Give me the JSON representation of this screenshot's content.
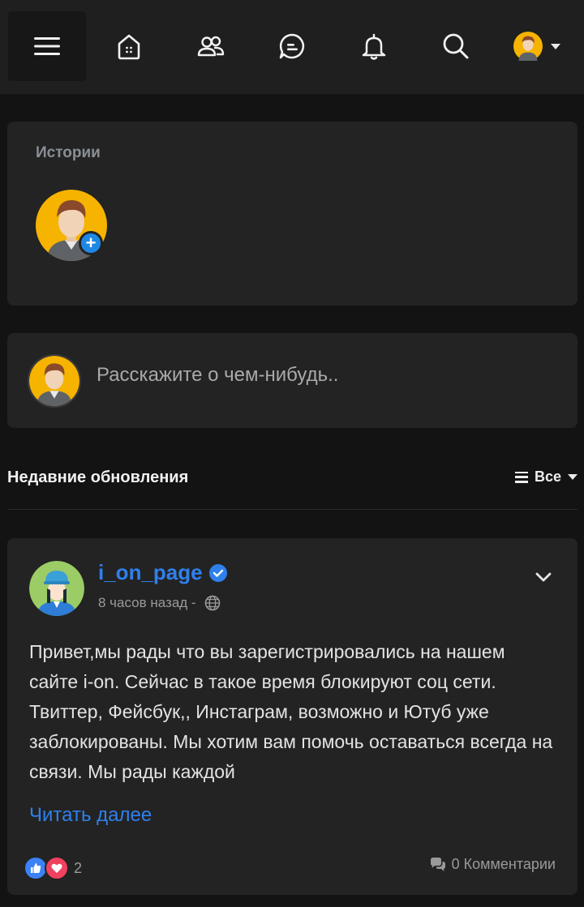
{
  "nav": {
    "items": [
      {
        "name": "menu-icon"
      },
      {
        "name": "home-icon"
      },
      {
        "name": "friends-icon"
      },
      {
        "name": "messages-icon"
      },
      {
        "name": "notifications-icon"
      },
      {
        "name": "search-icon"
      },
      {
        "name": "user-avatar-dropdown"
      }
    ]
  },
  "stories": {
    "title": "Истории"
  },
  "compose": {
    "placeholder": "Расскажите о чем-нибудь.."
  },
  "updates": {
    "title": "Недавние обновления",
    "filter_label": "Все"
  },
  "post": {
    "author": "i_on_page",
    "time": "8 часов назад -",
    "body": "Привет,мы рады что вы зарегистрировались на нашем сайте i-on. Сейчас в такое время блокируют соц сети. Твиттер, Фейсбук,, Инстаграм, возможно и Ютуб уже заблокированы. Мы хотим вам помочь оставаться всегда на связи. Мы рады каждой",
    "read_more": "Читать далее",
    "reaction_count": "2",
    "comments": "0 Комментарии"
  },
  "colors": {
    "accent": "#2f80ed",
    "background": "#131313",
    "card": "#232323",
    "nav": "#1f1f1f",
    "like": "#3b82f6",
    "love": "#f0415e"
  }
}
